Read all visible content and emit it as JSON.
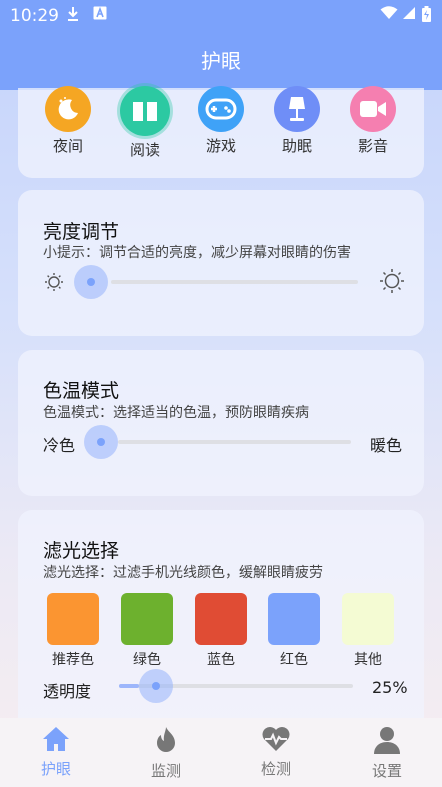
{
  "status": {
    "time": "10:29"
  },
  "header": {
    "title": "护眼"
  },
  "modes": [
    {
      "label": "夜间",
      "icon": "moon-icon",
      "color": "#f5a623"
    },
    {
      "label": "阅读",
      "icon": "book-icon",
      "color": "#2cc9a2"
    },
    {
      "label": "游戏",
      "icon": "gamepad-icon",
      "color": "#3fa2f7"
    },
    {
      "label": "助眠",
      "icon": "lamp-icon",
      "color": "#6f8ef7"
    },
    {
      "label": "影音",
      "icon": "video-icon",
      "color": "#f57fb0"
    }
  ],
  "brightness": {
    "title": "亮度调节",
    "hint": "小提示：调节合适的亮度，减少屏幕对眼睛的伤害",
    "value": 0.0
  },
  "color_temp": {
    "title": "色温模式",
    "hint": "色温模式：选择适当的色温，预防眼睛疾病",
    "left_label": "冷色",
    "right_label": "暖色",
    "value": 0.0
  },
  "filter": {
    "title": "滤光选择",
    "hint": "滤光选择：过滤手机光线颜色，缓解眼睛疲劳",
    "swatches": [
      {
        "label": "推荐色",
        "color": "#fb9531"
      },
      {
        "label": "绿色",
        "color": "#6db12e"
      },
      {
        "label": "蓝色",
        "color": "#e04c34"
      },
      {
        "label": "红色",
        "color": "#7ba2fb"
      },
      {
        "label": "其他",
        "color": "#f4fbd3"
      }
    ],
    "opacity_label": "透明度",
    "opacity_value": "25%",
    "opacity_fraction": 0.25
  },
  "nav": [
    {
      "label": "护眼",
      "icon": "home-icon",
      "active": true
    },
    {
      "label": "监测",
      "icon": "flame-icon",
      "active": false
    },
    {
      "label": "检测",
      "icon": "heart-pulse-icon",
      "active": false
    },
    {
      "label": "设置",
      "icon": "user-icon",
      "active": false
    }
  ],
  "colors": {
    "accent": "#7ba2fb",
    "inactive": "#777777"
  }
}
